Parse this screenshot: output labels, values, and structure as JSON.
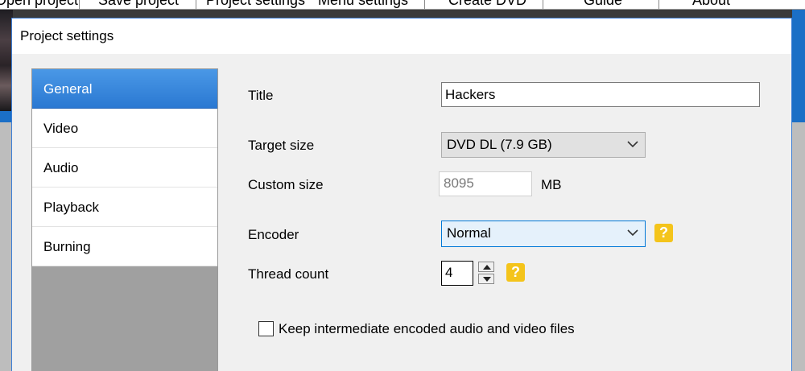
{
  "app_menu": {
    "items": [
      "Open project",
      "Save project",
      "Project settings",
      "Menu settings",
      "Create DVD",
      "Guide",
      "About"
    ]
  },
  "dialog": {
    "title": "Project settings"
  },
  "nav": {
    "items": [
      {
        "label": "General",
        "active": true
      },
      {
        "label": "Video",
        "active": false
      },
      {
        "label": "Audio",
        "active": false
      },
      {
        "label": "Playback",
        "active": false
      },
      {
        "label": "Burning",
        "active": false
      }
    ]
  },
  "form": {
    "title_label": "Title",
    "title_value": "Hackers",
    "target_size_label": "Target size",
    "target_size_value": "DVD DL (7.9 GB)",
    "custom_size_label": "Custom size",
    "custom_size_value": "8095",
    "custom_size_unit": "MB",
    "encoder_label": "Encoder",
    "encoder_value": "Normal",
    "thread_count_label": "Thread count",
    "thread_count_value": "4",
    "help_glyph": "?",
    "keep_files_label": "Keep intermediate encoded audio and video files",
    "keep_files_checked": false
  },
  "icons": {
    "dropdown": "chevron-down-icon",
    "spin_up": "arrow-up-icon",
    "spin_down": "arrow-down-icon",
    "help": "question-mark-icon"
  },
  "colors": {
    "accent": "#2a78d2",
    "help_badge": "#f4c41b",
    "dialog_bg": "#f0f0f0",
    "focus_border": "#0078d7"
  }
}
